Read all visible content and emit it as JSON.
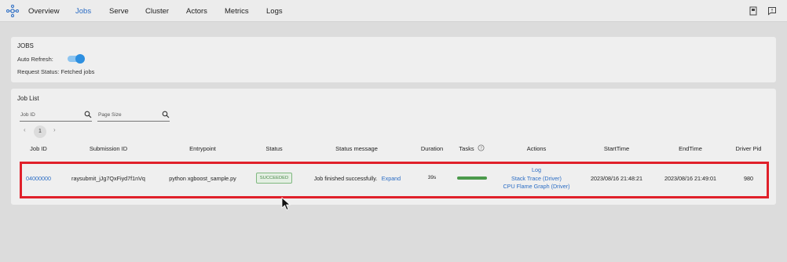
{
  "nav": {
    "items": [
      "Overview",
      "Jobs",
      "Serve",
      "Cluster",
      "Actors",
      "Metrics",
      "Logs"
    ],
    "active": "Jobs",
    "icons": [
      "book-icon",
      "feedback-icon"
    ]
  },
  "jobs_panel": {
    "title": "JOBS",
    "auto_refresh_label": "Auto Refresh:",
    "auto_refresh_on": true,
    "request_status": "Request Status: Fetched jobs"
  },
  "job_list": {
    "title": "Job List",
    "search_job_id_placeholder": "Job ID",
    "search_page_size_placeholder": "Page Size",
    "pager": {
      "prev": "‹",
      "current": "1",
      "next": "›"
    },
    "columns": [
      "Job ID",
      "Submission ID",
      "Entrypoint",
      "Status",
      "Status message",
      "Duration",
      "Tasks",
      "Actions",
      "StartTime",
      "EndTime",
      "Driver Pid"
    ],
    "row": {
      "job_id": "04000000",
      "submission_id": "raysubmit_jJg7QxFiyd7f1nVq",
      "entrypoint": "python xgboost_sample.py",
      "status": "SUCCEEDED",
      "status_message": "Job finished successfully.",
      "expand": "Expand",
      "duration": "39s",
      "tasks_progress": 1.0,
      "actions": [
        "Log",
        "Stack Trace (Driver)",
        "CPU Flame Graph (Driver)"
      ],
      "start_time": "2023/08/16 21:48:21",
      "end_time": "2023/08/16 21:49:01",
      "driver_pid": "980"
    }
  },
  "colors": {
    "accent": "#2a6cc4",
    "success": "#4b9a4b",
    "highlight": "#e0202a"
  }
}
